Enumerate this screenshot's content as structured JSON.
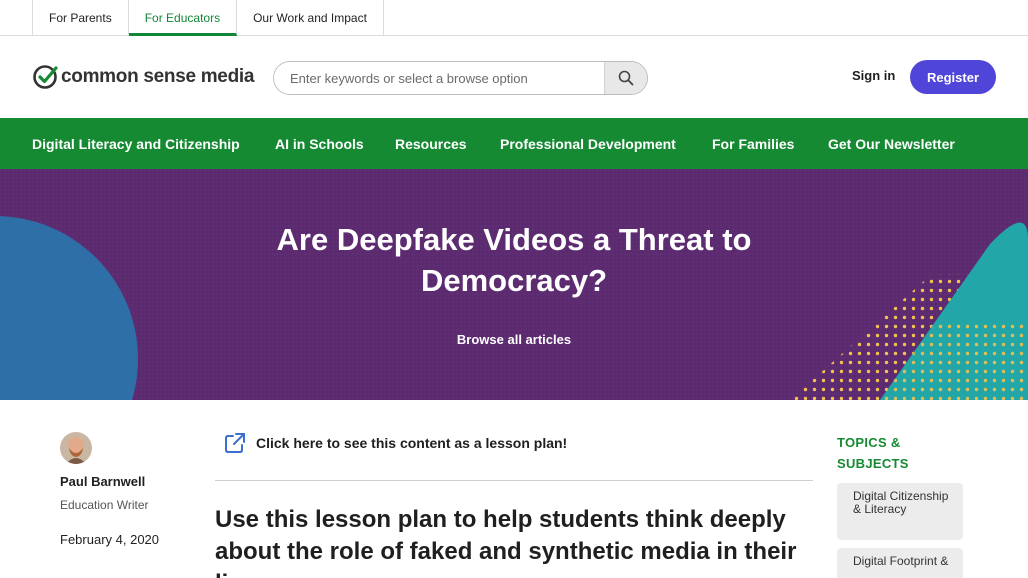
{
  "audience_tabs": [
    {
      "label": "For Parents"
    },
    {
      "label": "For Educators"
    },
    {
      "label": "Our Work and Impact"
    }
  ],
  "header": {
    "logo_text": "common sense media",
    "search_placeholder": "Enter keywords or select a browse option",
    "signin_label": "Sign in",
    "register_label": "Register"
  },
  "nav": {
    "items": [
      {
        "label": "Digital Literacy and Citizenship"
      },
      {
        "label": "AI in Schools"
      },
      {
        "label": "Resources"
      },
      {
        "label": "Professional Development"
      },
      {
        "label": "For Families"
      },
      {
        "label": "Get Our Newsletter"
      }
    ]
  },
  "hero": {
    "title": "Are Deepfake Videos a Threat to Democracy?",
    "browse_link": "Browse all articles"
  },
  "author": {
    "name": "Paul Barnwell",
    "role": "Education Writer",
    "date": "February 4, 2020"
  },
  "article": {
    "lesson_link": "Click here to see this content as a lesson plan!",
    "lede": "Use this lesson plan to help students think deeply about the role of faked and synthetic media in their li"
  },
  "topics": {
    "heading": "TOPICS & SUBJECTS",
    "chips": [
      {
        "label": "Digital Citizenship & Literacy"
      },
      {
        "label": "Digital Footprint &"
      }
    ]
  },
  "colors": {
    "brand_green": "#168a33",
    "hero_purple": "#5c2a6f",
    "register_blue": "#5045d9"
  }
}
